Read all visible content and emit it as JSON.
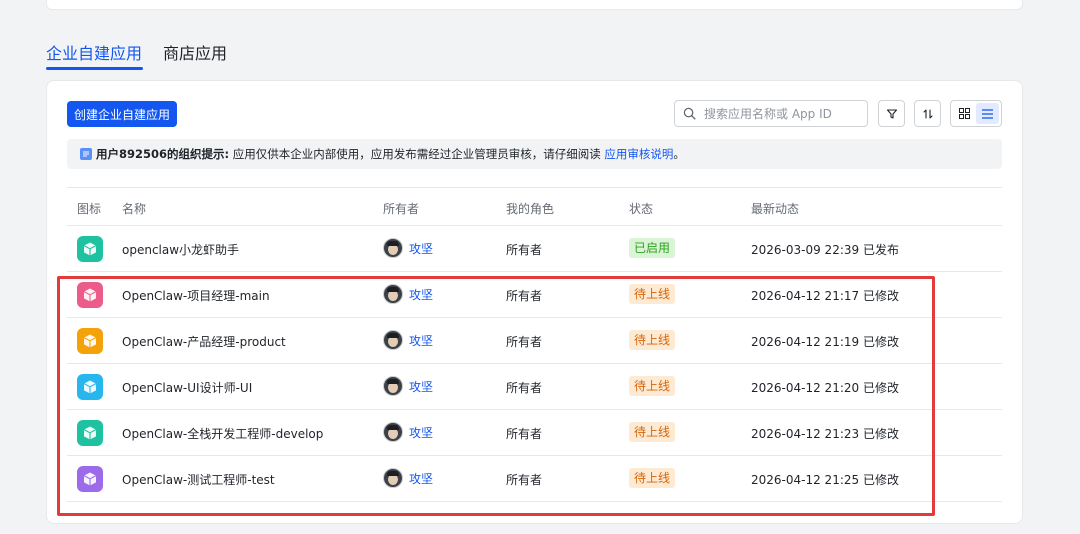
{
  "tabs": [
    {
      "label": "企业自建应用",
      "active": true
    },
    {
      "label": "商店应用",
      "active": false
    }
  ],
  "toolbar": {
    "create_label": "创建企业自建应用",
    "search_placeholder": "搜索应用名称或 App ID",
    "filter_icon": "filter-icon",
    "sort_icon": "sort-icon",
    "grid_view_icon": "grid-view-icon",
    "list_view_icon": "list-view-icon",
    "active_view": "list"
  },
  "notice": {
    "bold": "用户892506的组织提示:",
    "text": " 应用仅供本企业内部使用，应用发布需经过企业管理员审核，请仔细阅读 ",
    "link": "应用审核说明",
    "suffix": "。"
  },
  "table": {
    "headers": {
      "icon": "图标",
      "name": "名称",
      "owner": "所有者",
      "role": "我的角色",
      "status": "状态",
      "time": "最新动态"
    },
    "rows": [
      {
        "name": "openclaw小龙虾助手",
        "owner": "攻坚",
        "role": "所有者",
        "status": "已启用",
        "time": "2026-03-09 22:39 已发布"
      },
      {
        "name": "OpenClaw-项目经理-main",
        "owner": "攻坚",
        "role": "所有者",
        "status": "待上线",
        "time": "2026-04-12 21:17 已修改"
      },
      {
        "name": "OpenClaw-产品经理-product",
        "owner": "攻坚",
        "role": "所有者",
        "status": "待上线",
        "time": "2026-04-12 21:19 已修改"
      },
      {
        "name": "OpenClaw-UI设计师-UI",
        "owner": "攻坚",
        "role": "所有者",
        "status": "待上线",
        "time": "2026-04-12 21:20 已修改"
      },
      {
        "name": "OpenClaw-全栈开发工程师-develop",
        "owner": "攻坚",
        "role": "所有者",
        "status": "待上线",
        "time": "2026-04-12 21:23 已修改"
      },
      {
        "name": "OpenClaw-测试工程师-test",
        "owner": "攻坚",
        "role": "所有者",
        "status": "待上线",
        "time": "2026-04-12 21:25 已修改"
      }
    ]
  },
  "colors": {
    "accent": "#1456f0",
    "status_enabled": "#2ea121",
    "status_pending": "#d4660c",
    "highlight_border": "#e03c3c",
    "app_icons": [
      "#1fc2a0",
      "#ec5c8b",
      "#f5a20a",
      "#27b6ee",
      "#1fc2a0",
      "#9b6bea"
    ]
  }
}
